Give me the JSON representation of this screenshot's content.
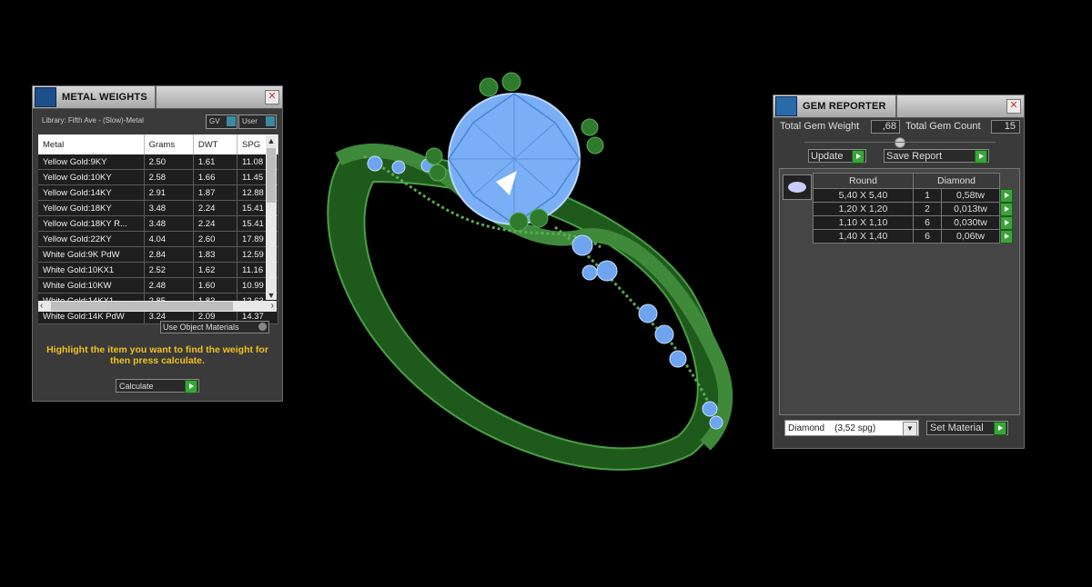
{
  "metal_weights": {
    "title": "METAL WEIGHTS",
    "library": "Library: Fifth Ave - (Slow)-Metal",
    "gv_label": "GV",
    "user_label": "User",
    "columns": [
      "Metal",
      "Grams",
      "DWT",
      "SPG"
    ],
    "rows": [
      [
        "Yellow Gold:9KY",
        "2.50",
        "1.61",
        "11.08"
      ],
      [
        "Yellow Gold:10KY",
        "2.58",
        "1.66",
        "11.45"
      ],
      [
        "Yellow Gold:14KY",
        "2.91",
        "1.87",
        "12.88"
      ],
      [
        "Yellow Gold:18KY",
        "3.48",
        "2.24",
        "15.41"
      ],
      [
        "Yellow Gold:18KY R...",
        "3.48",
        "2.24",
        "15.41"
      ],
      [
        "Yellow Gold:22KY",
        "4.04",
        "2.60",
        "17.89"
      ],
      [
        "White Gold:9K PdW",
        "2.84",
        "1.83",
        "12.59"
      ],
      [
        "White Gold:10KX1",
        "2.52",
        "1.62",
        "11.16"
      ],
      [
        "White Gold:10KW",
        "2.48",
        "1.60",
        "10.99"
      ],
      [
        "White Gold:14KX1",
        "2.85",
        "1.83",
        "12.63"
      ],
      [
        "White Gold:14K PdW",
        "3.24",
        "2.09",
        "14.37"
      ]
    ],
    "use_object_materials": "Use Object Materials",
    "hint": "Highlight the item you want to find the weight for then press calculate.",
    "calculate": "Calculate",
    "hint_color": "#f0c020"
  },
  "gem_reporter": {
    "title": "GEM REPORTER",
    "total_weight_label": "Total Gem Weight",
    "total_weight_value": ",68",
    "total_count_label": "Total Gem Count",
    "total_count_value": "15",
    "update": "Update",
    "save_report": "Save Report",
    "columns": [
      "Round",
      "Diamond"
    ],
    "rows": [
      [
        "5,40 X 5,40",
        "1",
        "0,58tw"
      ],
      [
        "1,20 X 1,20",
        "2",
        "0,013tw"
      ],
      [
        "1,10 X 1,10",
        "6",
        "0,030tw"
      ],
      [
        "1,40 X 1,40",
        "6",
        "0,06tw"
      ]
    ],
    "material_select": "Diamond    (3,52 spg)",
    "set_material": "Set Material"
  },
  "colors": {
    "ring_green": "#2f7a2c",
    "gem_blue": "#6fa5f0",
    "accent_green": "#3aa43a"
  }
}
